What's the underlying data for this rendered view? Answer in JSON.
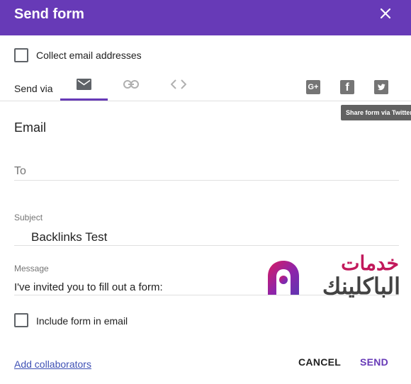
{
  "dialog": {
    "title": "Send form"
  },
  "collect_email": {
    "label": "Collect email addresses",
    "checked": false
  },
  "send_via": {
    "label": "Send via",
    "tabs": [
      {
        "icon": "email-icon",
        "selected": true
      },
      {
        "icon": "link-icon",
        "selected": false
      },
      {
        "icon": "embed-code-icon",
        "selected": false
      }
    ]
  },
  "share": {
    "buttons": [
      {
        "icon": "google-plus-icon",
        "glyph": "G+"
      },
      {
        "icon": "facebook-icon",
        "glyph": "f"
      },
      {
        "icon": "twitter-icon"
      }
    ],
    "tooltip": "Share form via Twitter"
  },
  "email": {
    "heading": "Email",
    "to": {
      "label": "",
      "placeholder": "To",
      "value": ""
    },
    "subject": {
      "label": "Subject",
      "value": "Backlinks Test"
    },
    "message": {
      "label": "Message",
      "value": "I've invited you to fill out a form:"
    },
    "include_form": {
      "label": "Include form in email",
      "checked": false
    }
  },
  "footer": {
    "add_collaborators": "Add collaborators",
    "cancel": "CANCEL",
    "send": "SEND"
  },
  "watermark": {
    "line1": "خدمات",
    "line2": "الباكلينك"
  },
  "colors": {
    "header": "#673ab7",
    "accent": "#673ab7",
    "link": "#3f51b5",
    "tooltip": "#616161",
    "share_button": "#757575"
  }
}
